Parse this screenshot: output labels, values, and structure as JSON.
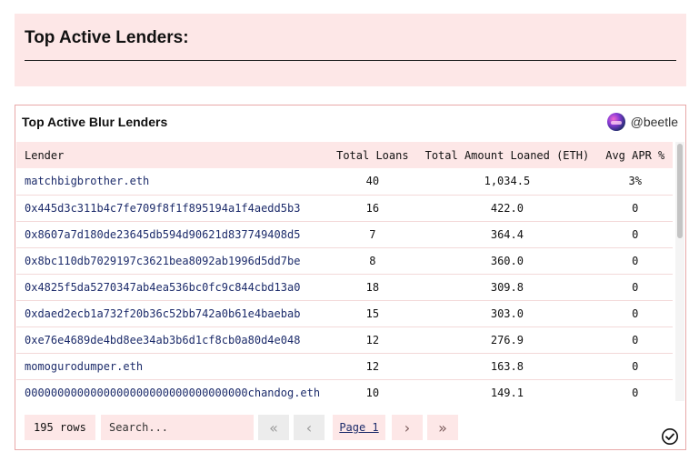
{
  "header": {
    "title": "Top Active Lenders:"
  },
  "card": {
    "title": "Top Active Blur Lenders",
    "author": "@beetle"
  },
  "table": {
    "columns": [
      "Lender",
      "Total Loans",
      "Total Amount Loaned (ETH)",
      "Avg APR %"
    ],
    "rows": [
      [
        "matchbigbrother.eth",
        "40",
        "1,034.5",
        "3%"
      ],
      [
        "0x445d3c311b4c7fe709f8f1f895194a1f4aedd5b3",
        "16",
        "422.0",
        "0"
      ],
      [
        "0x8607a7d180de23645db594d90621d837749408d5",
        "7",
        "364.4",
        "0"
      ],
      [
        "0x8bc110db7029197c3621bea8092ab1996d5dd7be",
        "8",
        "360.0",
        "0"
      ],
      [
        "0x4825f5da5270347ab4ea536bc0fc9c844cbd13a0",
        "18",
        "309.8",
        "0"
      ],
      [
        "0xdaed2ecb1a732f20b36c52bb742a0b61e4baebab",
        "15",
        "303.0",
        "0"
      ],
      [
        "0xe76e4689de4bd8ee34ab3b6d1cf8cb0a80d4e048",
        "12",
        "276.9",
        "0"
      ],
      [
        "momogurodumper.eth",
        "12",
        "163.8",
        "0"
      ],
      [
        "0000000000000000000000000000000000chandog.eth",
        "10",
        "149.1",
        "0"
      ],
      [
        "",
        "",
        "",
        ""
      ]
    ]
  },
  "footer": {
    "rows_count": "195 rows",
    "search_placeholder": "Search...",
    "page_label": "Page 1"
  },
  "icons": {
    "first": "double-chevron-left-icon",
    "prev": "chevron-left-icon",
    "next": "chevron-right-icon",
    "last": "double-chevron-right-icon",
    "status": "check-circle-icon"
  },
  "colors": {
    "panel_bg": "#fde7e7",
    "card_border": "#e8a9a9",
    "link_text": "#1d2c6b"
  }
}
